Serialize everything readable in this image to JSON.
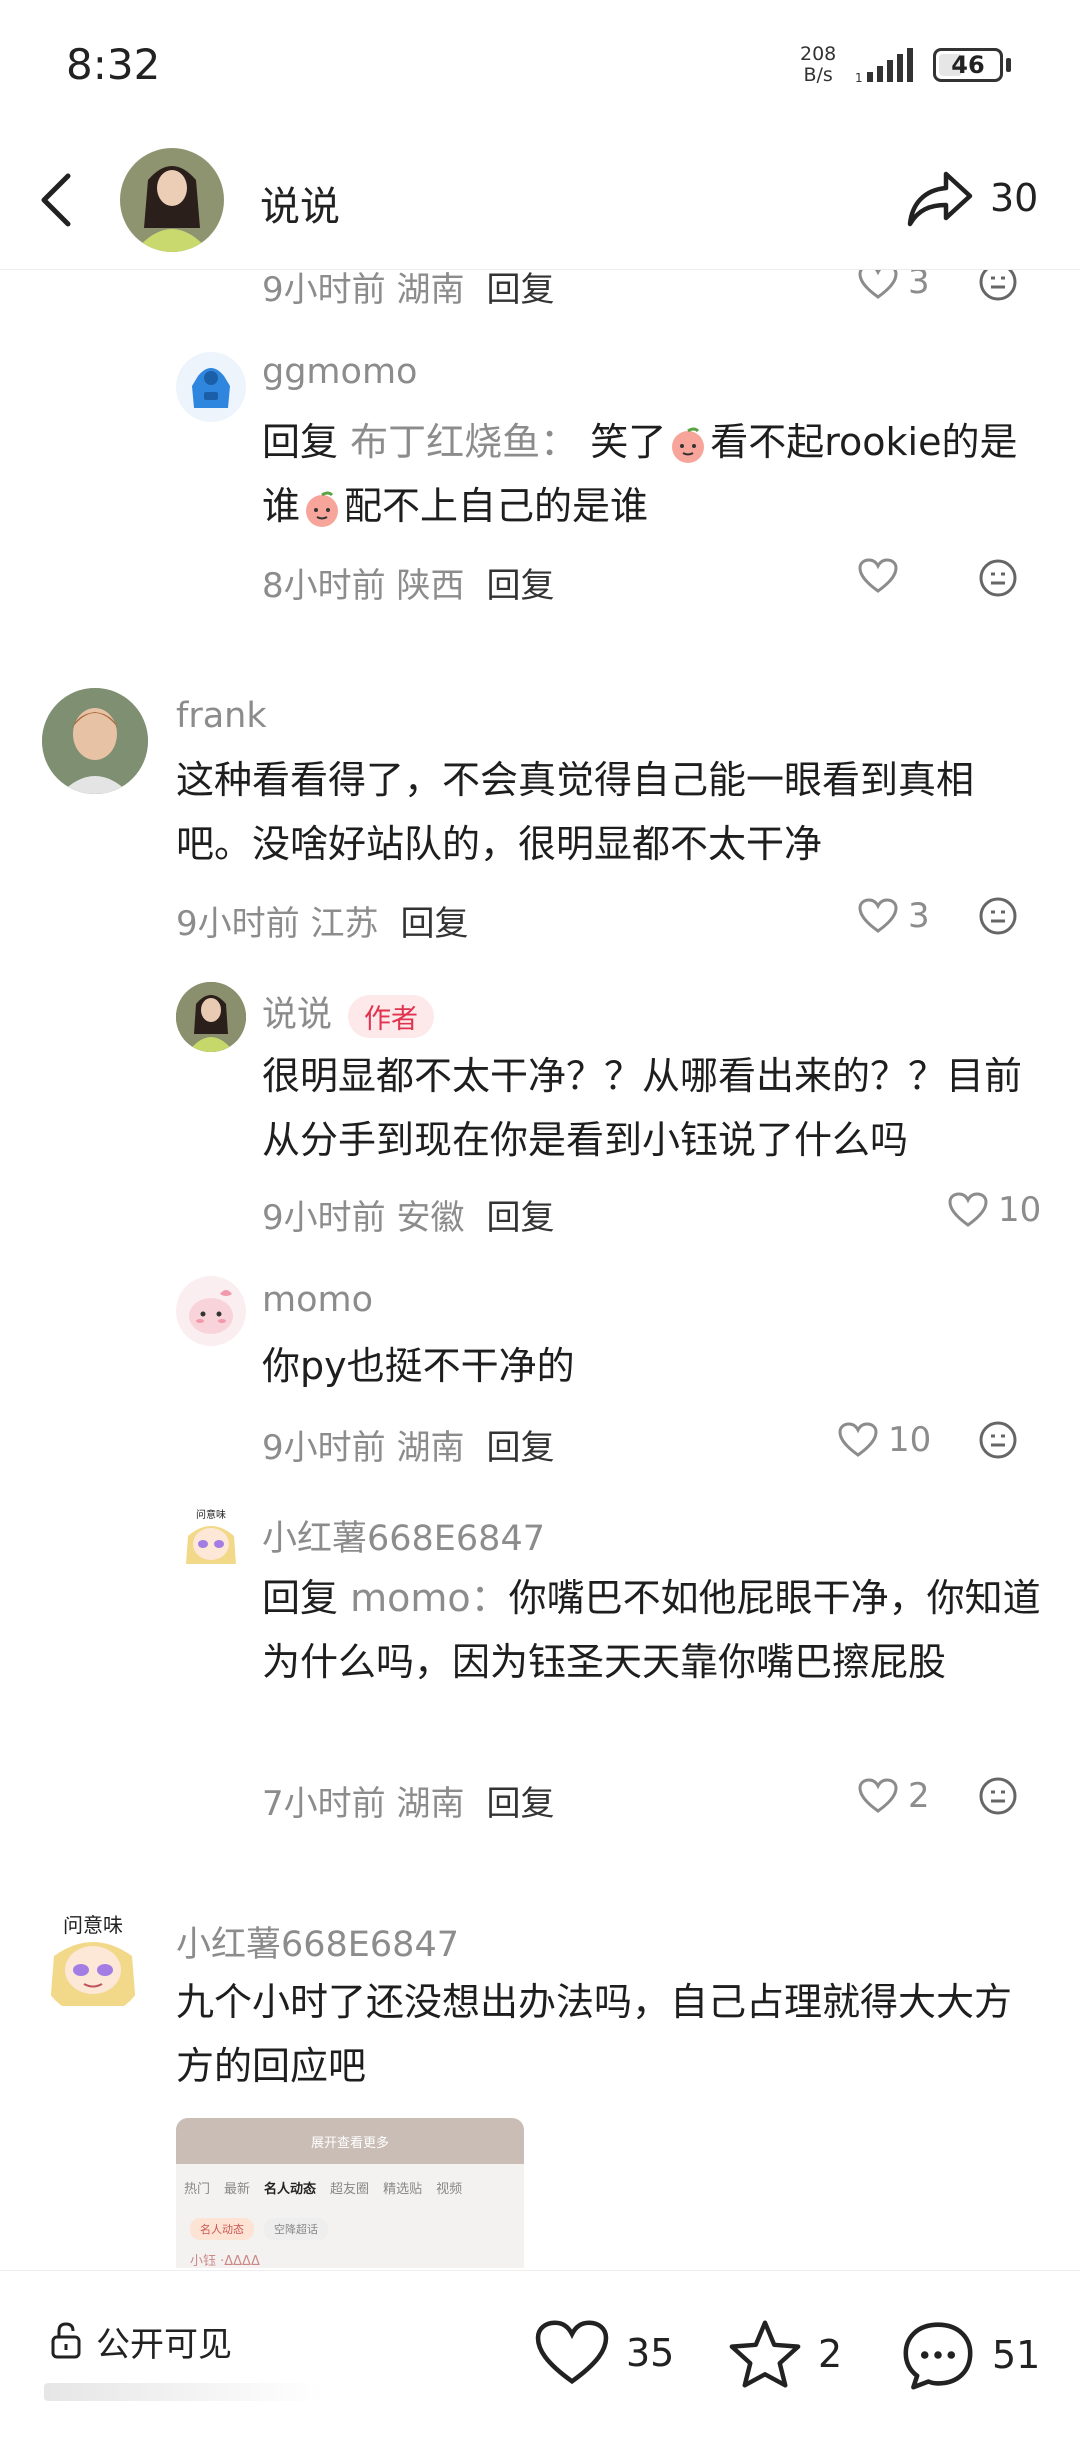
{
  "status": {
    "time": "8:32",
    "net_speed": "208\nB/s",
    "battery": "46",
    "battery_level": 0.46
  },
  "header": {
    "title": "说说",
    "share_count": "30"
  },
  "partial_row": {
    "meta": "9小时前 湖南",
    "reply": "回复",
    "likes": "3"
  },
  "comments": [
    {
      "name": "ggmomo",
      "reply_prefix": "回复",
      "reply_to": "布丁红烧鱼：",
      "text_a": "笑了",
      "emoji": "peach-face",
      "text_b": "看不起rookie的是谁",
      "text_c": "配不上自己的是谁",
      "time": "8小时前",
      "location": "陕西",
      "reply": "回复"
    },
    {
      "name": "frank",
      "text": "这种看看得了，不会真觉得自己能一眼看到真相吧。没啥好站队的，很明显都不太干净",
      "time": "9小时前",
      "location": "江苏",
      "reply": "回复",
      "likes": "3"
    },
    {
      "name": "说说",
      "badge": "作者",
      "text": "很明显都不太干净？？从哪看出来的？？目前从分手到现在你是看到小钰说了什么吗",
      "time": "9小时前",
      "location": "安徽",
      "reply": "回复",
      "likes": "10"
    },
    {
      "name": "momo",
      "text": "你py也挺不干净的",
      "time": "9小时前",
      "location": "湖南",
      "reply": "回复",
      "likes": "10"
    },
    {
      "name": "小红薯668E6847",
      "reply_prefix": "回复",
      "reply_to": "momo：",
      "text": "你嘴巴不如他屁眼干净，你知道为什么吗，因为钰圣天天靠你嘴巴擦屁股",
      "time": "7小时前",
      "location": "湖南",
      "reply": "回复",
      "likes": "2"
    },
    {
      "name": "小红薯668E6847",
      "text": "九个小时了还没想出办法吗，自己占理就得大大方方的回应吧",
      "avatar_caption": "问意味"
    }
  ],
  "screenshot_preview": {
    "hint": "展开查看更多",
    "tabs": [
      "热门",
      "最新",
      "名人动态",
      "超友圈",
      "精选贴",
      "视频"
    ],
    "active_tab": "名人动态",
    "chips": [
      "名人动态",
      "空降超话"
    ],
    "user": "小钰 ·ΔΔΔΔ"
  },
  "bottom_bar": {
    "visibility": "公开可见",
    "likes": "35",
    "collects": "2",
    "comments": "51"
  },
  "colors": {
    "author_badge_bg": "#fde8ea",
    "author_badge_text": "#e0334f",
    "meta_gray": "#8c8c8c"
  }
}
